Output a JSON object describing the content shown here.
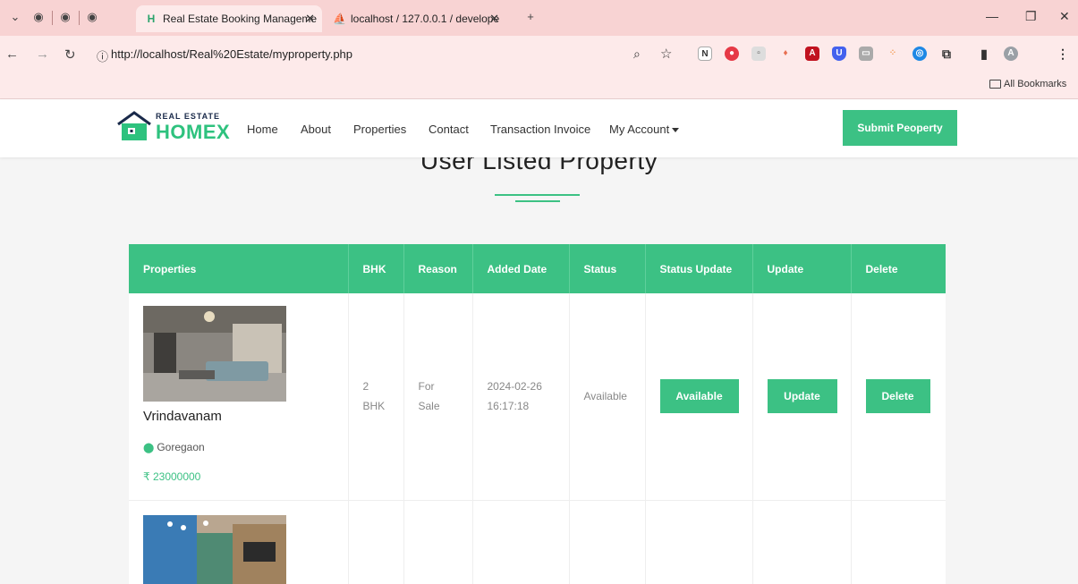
{
  "browser": {
    "tabs": [
      {
        "title": "Real Estate Booking Manageme",
        "favicon": "H",
        "active": true
      },
      {
        "title": "localhost / 127.0.0.1 / develope",
        "favicon": "phpmyadmin-icon",
        "active": false
      }
    ],
    "url": "http://localhost/Real%20Estate/myproperty.php",
    "bookmarks_label": "All Bookmarks",
    "profile_initial": "A"
  },
  "site": {
    "logo_top": "REAL ESTATE",
    "logo_main": "HOMEX",
    "menu": [
      "Home",
      "About",
      "Properties",
      "Contact",
      "Transaction Invoice",
      "My Account"
    ],
    "submit_button": "Submit Peoperty",
    "accent_color": "#3cc184"
  },
  "page": {
    "heading": "User Listed Property"
  },
  "table": {
    "headers": [
      "Properties",
      "BHK",
      "Reason",
      "Added Date",
      "Status",
      "Status Update",
      "Update",
      "Delete"
    ],
    "rows": [
      {
        "name": "Vrindavanam",
        "location": "Goregaon",
        "price": "₹ 23000000",
        "bhk_num": "2",
        "bhk_unit": "BHK",
        "reason_1": "For",
        "reason_2": "Sale",
        "date": "2024-02-26",
        "time": "16:17:18",
        "status": "Available",
        "status_btn": "Available",
        "update_btn": "Update",
        "delete_btn": "Delete"
      }
    ]
  }
}
